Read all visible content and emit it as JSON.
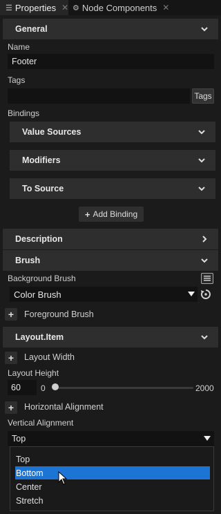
{
  "tabs": [
    {
      "label": "Properties",
      "icon": "list-icon",
      "active": true
    },
    {
      "label": "Node Components",
      "icon": "components-icon",
      "active": false
    }
  ],
  "general": {
    "header": "General",
    "name_label": "Name",
    "name_value": "Footer",
    "tags_label": "Tags",
    "tags_value": "",
    "tags_button": "Tags",
    "bindings_label": "Bindings",
    "bindings": [
      {
        "label": "Value Sources"
      },
      {
        "label": "Modifiers"
      },
      {
        "label": "To Source"
      }
    ],
    "add_binding": "Add Binding"
  },
  "description": {
    "header": "Description"
  },
  "brush": {
    "header": "Brush",
    "background_label": "Background Brush",
    "background_value": "Color Brush",
    "foreground_label": "Foreground Brush"
  },
  "layout_item": {
    "header": "Layout.Item",
    "width_label": "Layout Width",
    "height_label": "Layout Height",
    "height_value": "60",
    "slider_min": "0",
    "slider_max": "2000",
    "slider_value": 0,
    "horizontal_label": "Horizontal Alignment",
    "vertical_label": "Vertical Alignment",
    "vertical_value": "Top",
    "vertical_options": [
      "Top",
      "Bottom",
      "Center",
      "Stretch"
    ],
    "hovered_option": "Bottom"
  },
  "colors": {
    "background": "#1b1b1b",
    "header": "#2e2e2e",
    "field": "#121212",
    "selection": "#1c74d4"
  }
}
